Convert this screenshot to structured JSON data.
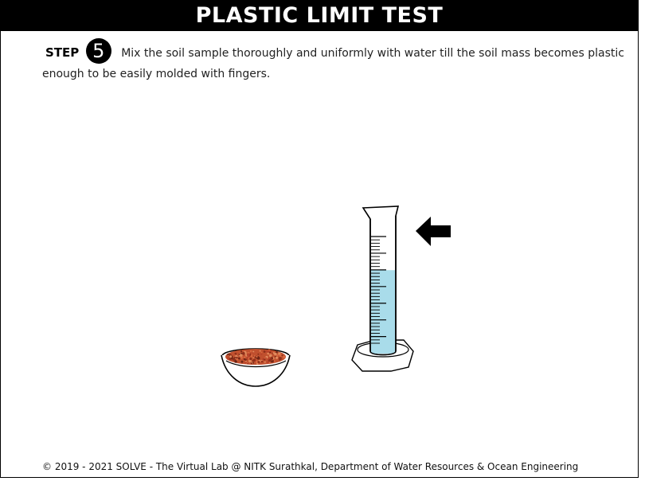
{
  "header": {
    "title": "PLASTIC LIMIT TEST"
  },
  "step": {
    "label": "STEP",
    "number": "5",
    "instruction": "Mix the soil sample thoroughly and uniformly with water till the soil mass becomes plastic enough to be easily molded with fingers."
  },
  "scene": {
    "water_fill_fraction": 0.62,
    "water_color": "#a9dcea",
    "soil_color": "#c0502e"
  },
  "footer": {
    "text": "© 2019 - 2021 SOLVE - The Virtual Lab @ NITK Surathkal, Department of Water Resources & Ocean Engineering"
  }
}
